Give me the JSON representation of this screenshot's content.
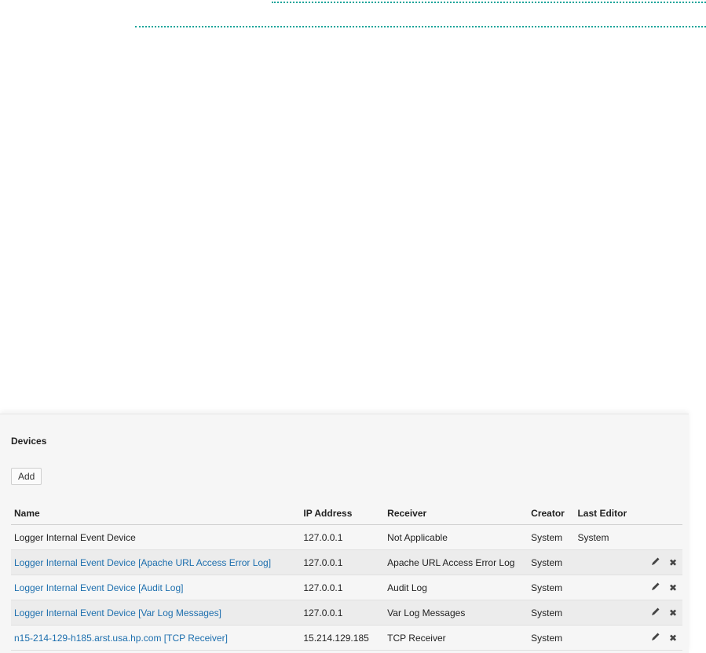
{
  "devices_panel": {
    "title": "Devices",
    "add_label": "Add",
    "columns": {
      "name": "Name",
      "ip": "IP Address",
      "receiver": "Receiver",
      "creator": "Creator",
      "last_editor": "Last Editor"
    },
    "rows": [
      {
        "name": "Logger Internal Event Device",
        "ip": "127.0.0.1",
        "receiver": "Not Applicable",
        "creator": "System",
        "last_editor": "System",
        "editable": false
      },
      {
        "name": "Logger Internal Event Device [Apache URL Access Error Log]",
        "ip": "127.0.0.1",
        "receiver": "Apache URL Access Error Log",
        "creator": "System",
        "last_editor": "",
        "editable": true
      },
      {
        "name": "Logger Internal Event Device [Audit Log]",
        "ip": "127.0.0.1",
        "receiver": "Audit Log",
        "creator": "System",
        "last_editor": "",
        "editable": true
      },
      {
        "name": "Logger Internal Event Device [Var Log Messages]",
        "ip": "127.0.0.1",
        "receiver": "Var Log Messages",
        "creator": "System",
        "last_editor": "",
        "editable": true
      },
      {
        "name": "n15-214-129-h185.arst.usa.hp.com [TCP Receiver]",
        "ip": "15.214.129.185",
        "receiver": "TCP Receiver",
        "creator": "System",
        "last_editor": "",
        "editable": true
      }
    ],
    "icons": {
      "edit": "pencil-icon",
      "delete": "close-icon"
    },
    "colors": {
      "link": "#1d6fae",
      "accent_dots": "#1aa59a"
    }
  }
}
